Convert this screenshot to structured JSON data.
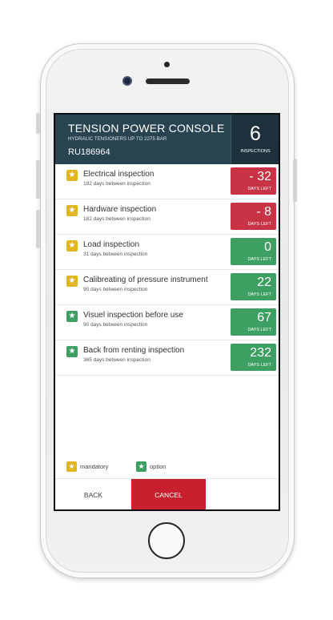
{
  "header": {
    "title": "TENSION POWER CONSOLE",
    "subtitle": "HYDRALIC TENSIONERS UP TO 2275 BAR",
    "id": "RU186964",
    "count": "6",
    "count_label": "INSPECTIONS"
  },
  "colors": {
    "header_bg": "#284451",
    "mandatory": "#e3b520",
    "option": "#3e9f63",
    "overdue": "#c83346",
    "cancel": "#c8202d"
  },
  "inspections": [
    {
      "title": "Electrical inspection",
      "subtitle": "182 days between inspection",
      "days": "- 32",
      "days_label": "DAYS LEFT",
      "type": "mandatory",
      "status": "overdue"
    },
    {
      "title": "Hardware inspection",
      "subtitle": "182 days between inspection",
      "days": "- 8",
      "days_label": "DAYS LEFT",
      "type": "mandatory",
      "status": "overdue"
    },
    {
      "title": "Load inspection",
      "subtitle": "31 days between inspection",
      "days": "0",
      "days_label": "DAYS LEFT",
      "type": "mandatory",
      "status": "ok"
    },
    {
      "title": "Calibreating of pressure instrument",
      "subtitle": "90 days between inspection",
      "days": "22",
      "days_label": "DAYS LEFT",
      "type": "mandatory",
      "status": "ok"
    },
    {
      "title": "Visuel inspection before use",
      "subtitle": "90 days between inspection",
      "days": "67",
      "days_label": "DAYS LEFT",
      "type": "option",
      "status": "ok"
    },
    {
      "title": "Back from renting inspection",
      "subtitle": "365 days between inspection",
      "days": "232",
      "days_label": "DAYS LEFT",
      "type": "option",
      "status": "ok"
    }
  ],
  "legend": {
    "mandatory_label": "mandatory",
    "option_label": "option",
    "icon": "star-icon"
  },
  "footer": {
    "back_label": "BACK",
    "cancel_label": "CANCEL"
  }
}
